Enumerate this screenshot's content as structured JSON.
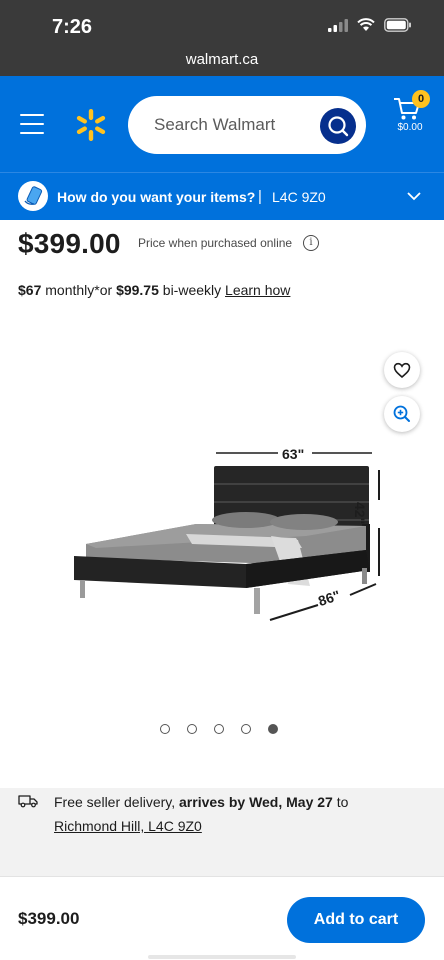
{
  "status": {
    "time": "7:26"
  },
  "browser": {
    "url": "walmart.ca"
  },
  "header": {
    "search_placeholder": "Search Walmart",
    "cart_count": "0",
    "cart_total": "$0.00",
    "brand_color": "#0071dc",
    "spark_color": "#ffc220"
  },
  "delivery_bar": {
    "question": "How do you want your items?",
    "separator": "|",
    "postal_code": "L4C 9Z0"
  },
  "product": {
    "price": "$399.00",
    "price_note": "Price when purchased online",
    "finance": {
      "monthly_amount": "$67",
      "monthly_text": " monthly*or ",
      "biweekly_amount": "$99.75",
      "biweekly_text": " bi-weekly ",
      "learn_link": "Learn how"
    },
    "dimensions": {
      "width": "63\"",
      "height": "42\"",
      "length": "86\""
    },
    "image_count": 5,
    "active_image": 5
  },
  "shipping": {
    "prefix": "Free seller delivery, ",
    "arrival": "arrives by Wed, May 27",
    "to": " to",
    "location": "Richmond Hill, L4C 9Z0"
  },
  "bottom_bar": {
    "price": "$399.00",
    "add_to_cart": "Add to cart"
  }
}
